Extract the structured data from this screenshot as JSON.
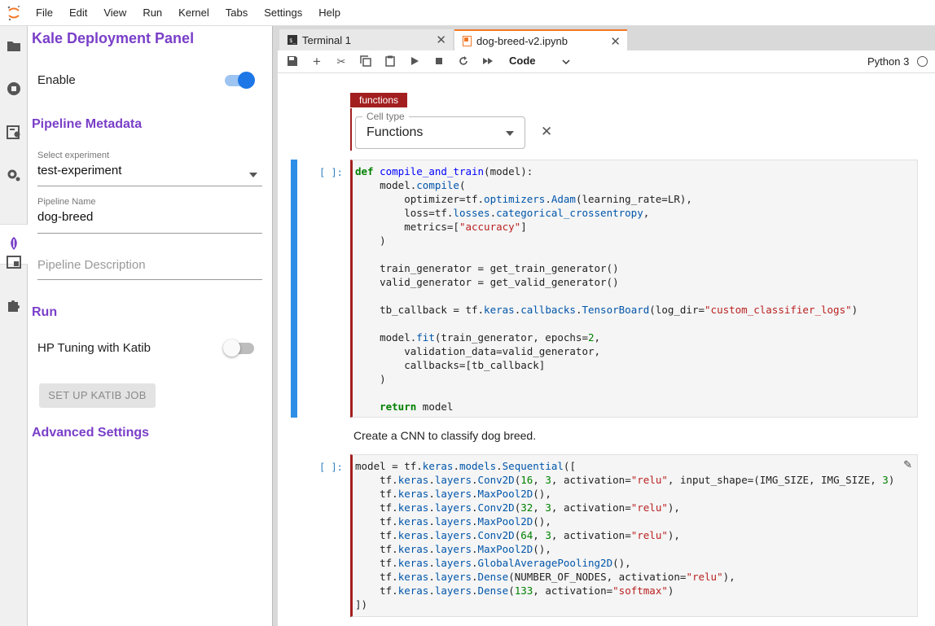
{
  "menubar": {
    "items": [
      "File",
      "Edit",
      "View",
      "Run",
      "Kernel",
      "Tabs",
      "Settings",
      "Help"
    ]
  },
  "leftbar": {
    "icons": [
      "folder-icon",
      "stop-circle-icon",
      "property-inspector-icon",
      "gear-icon",
      "kale-icon",
      "window-icon",
      "extension-puzzle-icon"
    ]
  },
  "kale": {
    "title": "Kale Deployment Panel",
    "enable_label": "Enable",
    "enable_on": true,
    "metadata_title": "Pipeline Metadata",
    "experiment_label": "Select experiment",
    "experiment_value": "test-experiment",
    "pipeline_name_label": "Pipeline Name",
    "pipeline_name_value": "dog-breed",
    "pipeline_description_placeholder": "Pipeline Description",
    "run_title": "Run",
    "hp_label": "HP Tuning with Katib",
    "hp_on": false,
    "katib_button": "SET UP KATIB JOB",
    "advanced_title": "Advanced Settings"
  },
  "tabs": [
    {
      "label": "Terminal 1",
      "active": false
    },
    {
      "label": "dog-breed-v2.ipynb",
      "active": true
    }
  ],
  "toolbar": {
    "cell_type": "Code",
    "kernel": "Python 3"
  },
  "notebook": {
    "tag": "functions",
    "cell_type_label": "Cell type",
    "cell_type_value": "Functions",
    "prompt1": "[ ]:",
    "prompt2": "[ ]:",
    "markdown": "Create a CNN to classify dog breed."
  },
  "colors": {
    "accent_purple": "#7a3fc8",
    "toggle_blue": "#1e77e6",
    "tag_red": "#a31f1f",
    "cell_active_blue": "#2f8ee6"
  }
}
